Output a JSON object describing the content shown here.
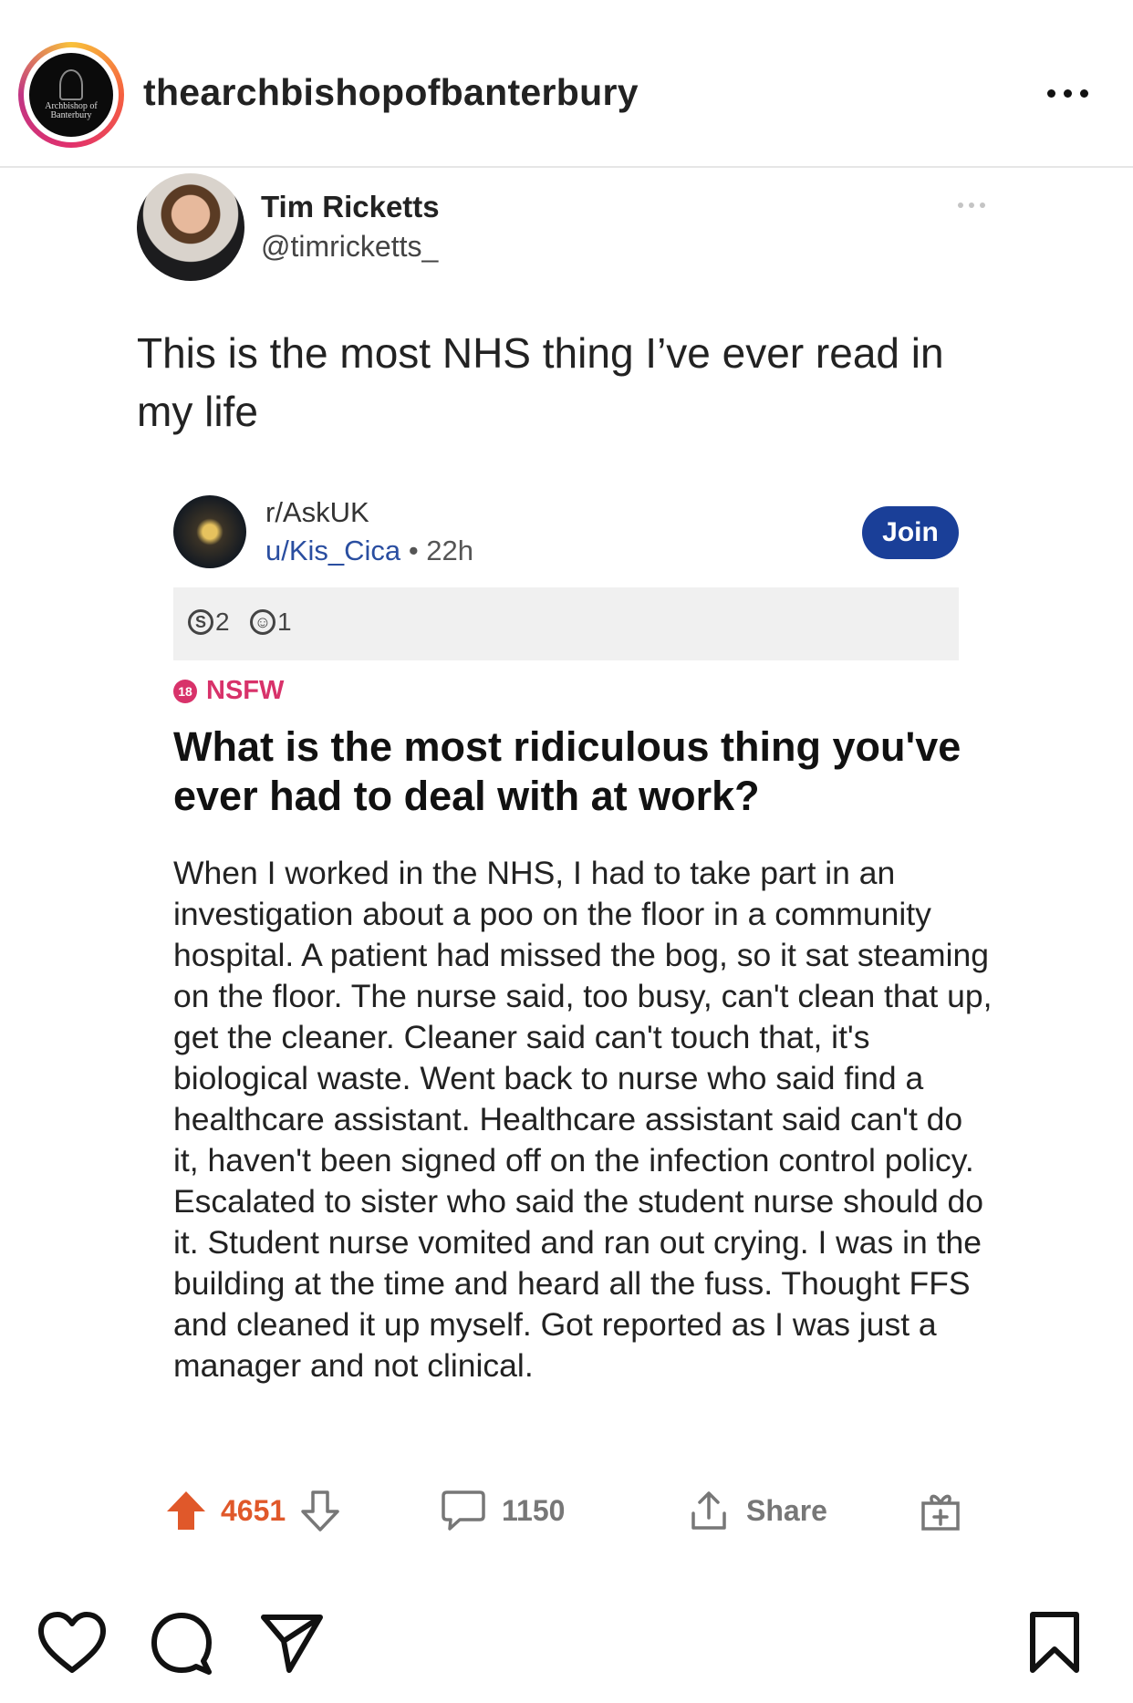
{
  "instagram": {
    "username": "thearchbishopofbanterbury",
    "avatar_text": "Archbishop of Banterbury",
    "icons": [
      "more-icon",
      "heart-icon",
      "comment-icon",
      "send-icon",
      "bookmark-icon"
    ]
  },
  "tweet": {
    "name": "Tim Ricketts",
    "handle": "@timricketts_",
    "text": "This is the most NHS thing I’ve ever read in my life"
  },
  "reddit": {
    "subreddit": "r/AskUK",
    "user": "u/Kis_Cica",
    "separator": "•",
    "time": "22h",
    "join_label": "Join",
    "awards": [
      {
        "icon": "silver-award-icon",
        "count": "2"
      },
      {
        "icon": "helpful-award-icon",
        "count": "1"
      }
    ],
    "nsfw_badge": "18",
    "nsfw_label": "NSFW",
    "title": "What is the most ridiculous thing you've ever had to deal with at work?",
    "body": "When I worked in the NHS, I had to take part in an investigation about a poo on the floor in a community hospital. A patient had missed the bog, so it sat steaming on the floor. The nurse said, too busy, can't clean that up, get the cleaner. Cleaner said can't touch that, it's biological waste. Went back to nurse who said find a healthcare assistant. Healthcare assistant said can't do it, haven't been signed off on the infection control policy. Escalated to sister who said the student nurse should do it. Student nurse vomited and ran out crying. I was in the building at the time and heard all the fuss. Thought FFS and cleaned it up myself. Got reported as I was just a manager and not clinical.",
    "upvotes": "4651",
    "comments": "1150",
    "share_label": "Share",
    "colors": {
      "upvote": "#e0582a",
      "join": "#1a3f98",
      "nsfw": "#d8326a"
    }
  }
}
